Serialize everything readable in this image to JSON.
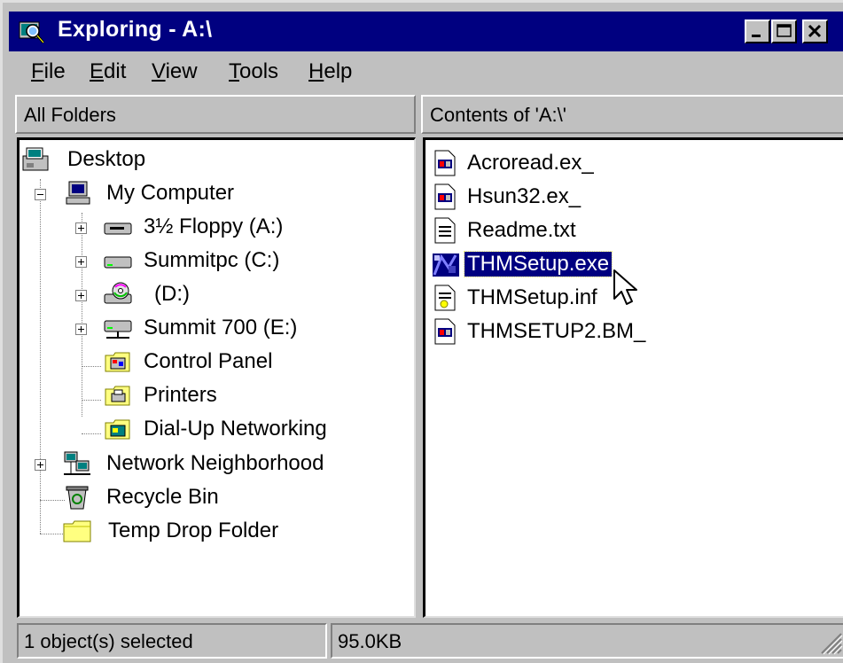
{
  "window": {
    "title": "Exploring - A:\\",
    "controls": {
      "minimize": "minimize",
      "maximize": "maximize",
      "close": "close"
    }
  },
  "menu": {
    "items": [
      {
        "label": "File",
        "accel": "F",
        "rest": "ile"
      },
      {
        "label": "Edit",
        "accel": "E",
        "rest": "dit"
      },
      {
        "label": "View",
        "accel": "V",
        "rest": "iew"
      },
      {
        "label": "Tools",
        "accel": "T",
        "rest": "ools"
      },
      {
        "label": "Help",
        "accel": "H",
        "rest": "elp"
      }
    ]
  },
  "left_pane": {
    "header": "All Folders",
    "tree": [
      {
        "label": "Desktop",
        "icon": "desktop-icon"
      },
      {
        "label": "My Computer",
        "icon": "computer-icon",
        "expander": "minus"
      },
      {
        "label": "3½ Floppy (A:)",
        "icon": "floppy-drive-icon",
        "expander": "plus"
      },
      {
        "label": "Summitpc (C:)",
        "icon": "hard-drive-icon",
        "expander": "plus"
      },
      {
        "label": "(D:)",
        "icon": "cd-drive-icon",
        "expander": "plus"
      },
      {
        "label": "Summit 700 (E:)",
        "icon": "network-drive-icon",
        "expander": "plus"
      },
      {
        "label": "Control Panel",
        "icon": "control-panel-icon"
      },
      {
        "label": "Printers",
        "icon": "printers-folder-icon"
      },
      {
        "label": "Dial-Up Networking",
        "icon": "dialup-folder-icon"
      },
      {
        "label": "Network Neighborhood",
        "icon": "network-neighborhood-icon",
        "expander": "plus"
      },
      {
        "label": "Recycle Bin",
        "icon": "recycle-bin-icon"
      },
      {
        "label": "Temp Drop Folder",
        "icon": "folder-icon"
      }
    ]
  },
  "right_pane": {
    "header": "Contents of 'A:\\'",
    "files": [
      {
        "label": "Acroread.ex_",
        "icon": "compressed-file-icon",
        "selected": false
      },
      {
        "label": "Hsun32.ex_",
        "icon": "compressed-file-icon",
        "selected": false
      },
      {
        "label": "Readme.txt",
        "icon": "text-file-icon",
        "selected": false
      },
      {
        "label": "THMSetup.exe",
        "icon": "setup-exe-icon",
        "selected": true
      },
      {
        "label": "THMSetup.inf",
        "icon": "inf-file-icon",
        "selected": false
      },
      {
        "label": "THMSETUP2.BM_",
        "icon": "compressed-file-icon",
        "selected": false
      }
    ]
  },
  "status": {
    "selection": "1 object(s) selected",
    "size": "95.0KB"
  },
  "colors": {
    "titlebar": "#000080",
    "face": "#c0c0c0",
    "selection": "#000080"
  }
}
